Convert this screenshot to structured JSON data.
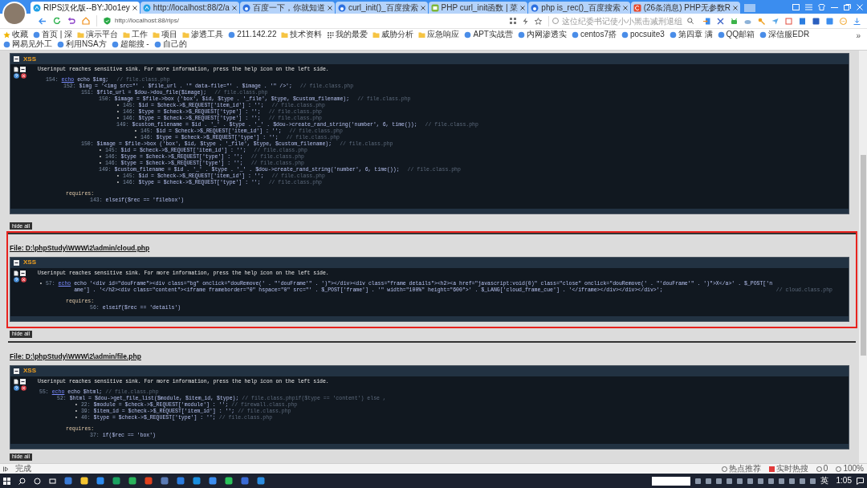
{
  "browser": {
    "tabs": [
      {
        "title": "RIPS汉化版--BY:J0o1ey",
        "kind": "rips",
        "selected": true
      },
      {
        "title": "http://localhost:88/2/a",
        "kind": "rips",
        "selected": false
      },
      {
        "title": "百度一下，你就知道",
        "kind": "baidu",
        "selected": false
      },
      {
        "title": "curl_init()_百度搜索",
        "kind": "baidu",
        "selected": false
      },
      {
        "title": "PHP curl_init函数 | 菜",
        "kind": "runoob",
        "selected": false
      },
      {
        "title": "php is_rec()_百度搜索",
        "kind": "baidu",
        "selected": false
      },
      {
        "title": "(26条消息) PHP无参数R",
        "kind": "csdn",
        "selected": false
      }
    ],
    "address": "http://localhost:88/rips/",
    "search": {
      "placeholder": "这位纪委书记使小小黑击减刑退组"
    },
    "bookmarks": [
      {
        "label": "收藏",
        "kind": "star"
      },
      {
        "label": "首页 | 深",
        "kind": "site"
      },
      {
        "label": "演示平台",
        "kind": "folder"
      },
      {
        "label": "工作",
        "kind": "folder"
      },
      {
        "label": "项目",
        "kind": "folder"
      },
      {
        "label": "渗透工具",
        "kind": "folder"
      },
      {
        "label": "211.142.22",
        "kind": "site"
      },
      {
        "label": "技术资料",
        "kind": "folder"
      },
      {
        "label": "我的最爱",
        "kind": "grid"
      },
      {
        "label": "威胁分析",
        "kind": "folder"
      },
      {
        "label": "应急响应",
        "kind": "folder"
      },
      {
        "label": "APT实战营",
        "kind": "site"
      },
      {
        "label": "内网渗透实",
        "kind": "site"
      },
      {
        "label": "centos7搭",
        "kind": "site"
      },
      {
        "label": "pocsuite3",
        "kind": "site"
      },
      {
        "label": "第四章 满",
        "kind": "site"
      },
      {
        "label": "QQ邮箱",
        "kind": "site"
      },
      {
        "label": "深信服EDR",
        "kind": "site"
      },
      {
        "label": "网易见外工",
        "kind": "site"
      },
      {
        "label": "利用NSA方",
        "kind": "site"
      },
      {
        "label": "超能搜 -",
        "kind": "site"
      },
      {
        "label": "自己的",
        "kind": "site"
      }
    ],
    "bookmarks_more": "»"
  },
  "report": {
    "top_block": {
      "title": "XSS",
      "description": "Userinput reaches sensitive sink. For more information, press the help icon on the left side.",
      "trace": [
        {
          "num": "154:",
          "link": "echo",
          "code": "echo $img;",
          "comment": "// file.class.php",
          "children": [
            {
              "num": "152:",
              "code": "$img = '<img src=\"' . $file_url . '\" data-file=\"' . $image . '\" />';",
              "comment": "// file.class.php",
              "children": [
                {
                  "num": "151:",
                  "code": "$file_url = $dou->dou_file($image);",
                  "comment": "// file.class.php",
                  "children": [
                    {
                      "num": "150:",
                      "code": "$image = $file->box ('box', $id, $type . '_file', $type, $custom_filename);",
                      "comment": "// file.class.php",
                      "children": [
                        {
                          "marker": "•",
                          "num": "145:",
                          "code": "$id = $check->$_REQUEST['item_id'] : '';",
                          "comment": "// file.class.php"
                        },
                        {
                          "marker": "•",
                          "num": "146:",
                          "code": "$type = $check->$_REQUEST['type'] : '';",
                          "comment": "// file.class.php"
                        },
                        {
                          "marker": "•",
                          "num": "146:",
                          "code": "$type = $check->$_REQUEST['type'] : '';",
                          "comment": "// file.class.php"
                        },
                        {
                          "num": "149:",
                          "code": "$custom_filename = $id . '_' . $type . '_' . $dou->create_rand_string('number', 6, time());",
                          "comment": "// file.class.php",
                          "children": [
                            {
                              "marker": "•",
                              "num": "145:",
                              "code": "$id = $check->$_REQUEST['item_id'] : '';",
                              "comment": "// file.class.php"
                            },
                            {
                              "marker": "•",
                              "num": "146:",
                              "code": "$type = $check->$_REQUEST['type'] : '';",
                              "comment": "// file.class.php"
                            }
                          ]
                        }
                      ]
                    }
                  ]
                },
                {
                  "num": "150:",
                  "code": "$image = $file->box ('box', $id, $type . '_file', $type, $custom_filename);",
                  "comment": "// file.class.php",
                  "children": [
                    {
                      "marker": "•",
                      "num": "145:",
                      "code": "$id = $check->$_REQUEST['item_id'] : '';",
                      "comment": "// file.class.php"
                    },
                    {
                      "marker": "•",
                      "num": "146:",
                      "code": "$type = $check->$_REQUEST['type'] : '';",
                      "comment": "// file.class.php"
                    },
                    {
                      "marker": "•",
                      "num": "146:",
                      "code": "$type = $check->$_REQUEST['type'] : '';",
                      "comment": "// file.class.php"
                    },
                    {
                      "num": "149:",
                      "code": "$custom_filename = $id . '_' . $type . '_' . $dou->create_rand_string('number', 6, time());",
                      "comment": "// file.class.php",
                      "children": [
                        {
                          "marker": "•",
                          "num": "145:",
                          "code": "$id = $check->$_REQUEST['item_id'] : '';",
                          "comment": "// file.class.php"
                        },
                        {
                          "marker": "•",
                          "num": "146:",
                          "code": "$type = $check->$_REQUEST['type'] : '';",
                          "comment": "// file.class.php"
                        }
                      ]
                    }
                  ]
                }
              ]
            }
          ]
        }
      ],
      "requires_label": "requires:",
      "requires": [
        {
          "num": "143:",
          "code": "elseif($rec == 'filebox')"
        }
      ]
    },
    "top_hide_all": "hide all",
    "files": [
      {
        "path": "File: D:\\phpStudy\\WWW\\2\\admin/cloud.php",
        "highlighted": true,
        "block": {
          "title": "XSS",
          "description": "Userinput reaches sensitive sink. For more information, press the help icon on the left side.",
          "trace": [
            {
              "marker": "•",
              "num": "57:",
              "link": "echo",
              "code": "echo '<div id=\"douFrame\"><div class=\"bg\" onclick=\"douRemove(' . \"'douFrame'\" . ')\"></div><div class=\"frame details\"><h2><a href=\"javascript:void(0)\" class=\"close\" onclick=\"douRemove(' . \"'douFrame'\" . ')\">X</a>' . $_POST['name'] . '</h2><div class=\"content\"><iframe frameborder=\"0\" hspace=\"0\" src=\"' . $_POST['frame'] . '\" width=\"100%\" height=\"600\">' . $_LANG['cloud_frame_cue'] . '</iframe></div></div></div>';",
              "comment": "// cloud.class.php"
            }
          ],
          "requires_label": "requires:",
          "requires": [
            {
              "num": "56:",
              "code": "elseif($rec == 'details')"
            }
          ]
        },
        "hide_all": "hide all"
      },
      {
        "path": "File: D:\\phpStudy\\WWW\\2\\admin/file.php",
        "highlighted": false,
        "block": {
          "title": "XSS",
          "description": "Userinput reaches sensitive sink. For more information, press the help icon on the left side.",
          "trace": [
            {
              "num": "55:",
              "link": "echo",
              "code": "echo $html;",
              "comment": "// file.class.php",
              "children": [
                {
                  "num": "52:",
                  "code": "$html = $dou->get_file_list($module, $item_id, $type);",
                  "comment": "// file.class.phpif($type == 'content') else ,",
                  "children": [
                    {
                      "marker": "•",
                      "num": "22:",
                      "code": "$module = $check->$_REQUEST['module'] : '';",
                      "comment": "// firewall.class.php"
                    },
                    {
                      "marker": "•",
                      "num": "39:",
                      "code": "$item_id = $check->$_REQUEST['item_id'] : '';",
                      "comment": "// file.class.php"
                    },
                    {
                      "marker": "•",
                      "num": "40:",
                      "code": "$type = $check->$_REQUEST['type'] : '';",
                      "comment": "// file.class.php"
                    }
                  ]
                }
              ]
            }
          ],
          "requires_label": "requires:",
          "requires": [
            {
              "num": "37:",
              "code": "if($rec == 'box')"
            }
          ]
        },
        "hide_all": "hide all"
      }
    ]
  },
  "status_bar": {
    "text": "完成",
    "items": [
      "热点推荐",
      "实时热搜",
      "0",
      "100%"
    ]
  },
  "taskbar": {
    "ime": "英",
    "time": "1:05"
  }
}
